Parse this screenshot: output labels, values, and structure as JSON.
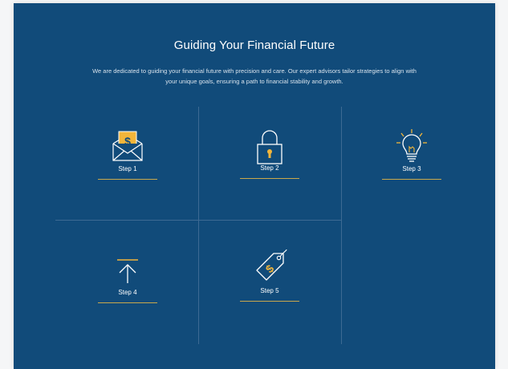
{
  "section": {
    "title": "Guiding Your Financial Future",
    "description": "We are dedicated to guiding your financial future with precision and care. Our expert advisors tailor strategies to align with your unique goals, ensuring a path to financial stability and growth."
  },
  "steps": [
    {
      "label": "Step 1",
      "icon": "envelope-dollar-icon"
    },
    {
      "label": "Step 2",
      "icon": "padlock-icon"
    },
    {
      "label": "Step 3",
      "icon": "lightbulb-icon"
    },
    {
      "label": "Step 4",
      "icon": "upload-arrow-icon"
    },
    {
      "label": "Step 5",
      "icon": "price-tag-dollar-icon"
    }
  ],
  "colors": {
    "background": "#114b7a",
    "accent": "#f2b53a",
    "underline": "#c9a84c",
    "divider": "#3d6a93"
  }
}
